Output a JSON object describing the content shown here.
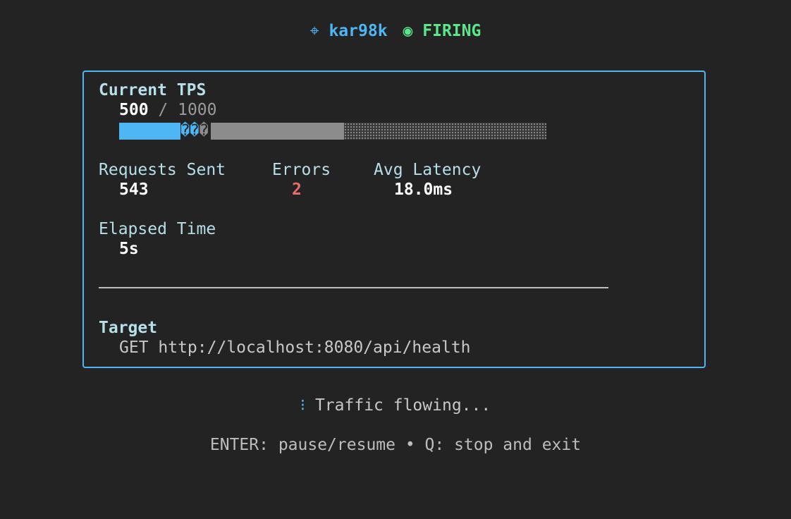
{
  "header": {
    "app_icon": "⌖",
    "app_name": "kar98k",
    "status_icon": "◉",
    "status_text": "FIRING"
  },
  "tps": {
    "label": "Current TPS",
    "current": "500",
    "separator": " / ",
    "max": "1000",
    "progress_fraction": 0.5,
    "bar_glyphs": "��",
    "bar_glyph_dim": "�"
  },
  "stats": {
    "requests_label": "Requests Sent",
    "requests_value": "543",
    "errors_label": "Errors",
    "errors_value": "2",
    "latency_label": "Avg Latency",
    "latency_value": "18.0ms"
  },
  "elapsed": {
    "label": "Elapsed Time",
    "value": "5s"
  },
  "target": {
    "label": "Target",
    "value": "GET http://localhost:8080/api/health"
  },
  "footer": {
    "spinner": "⁝",
    "status": "Traffic flowing...",
    "help": "ENTER: pause/resume • Q: stop and exit"
  },
  "colors": {
    "accent": "#4fb6f5",
    "success": "#5ce68a",
    "error": "#ec6c6c",
    "background": "#232323"
  }
}
